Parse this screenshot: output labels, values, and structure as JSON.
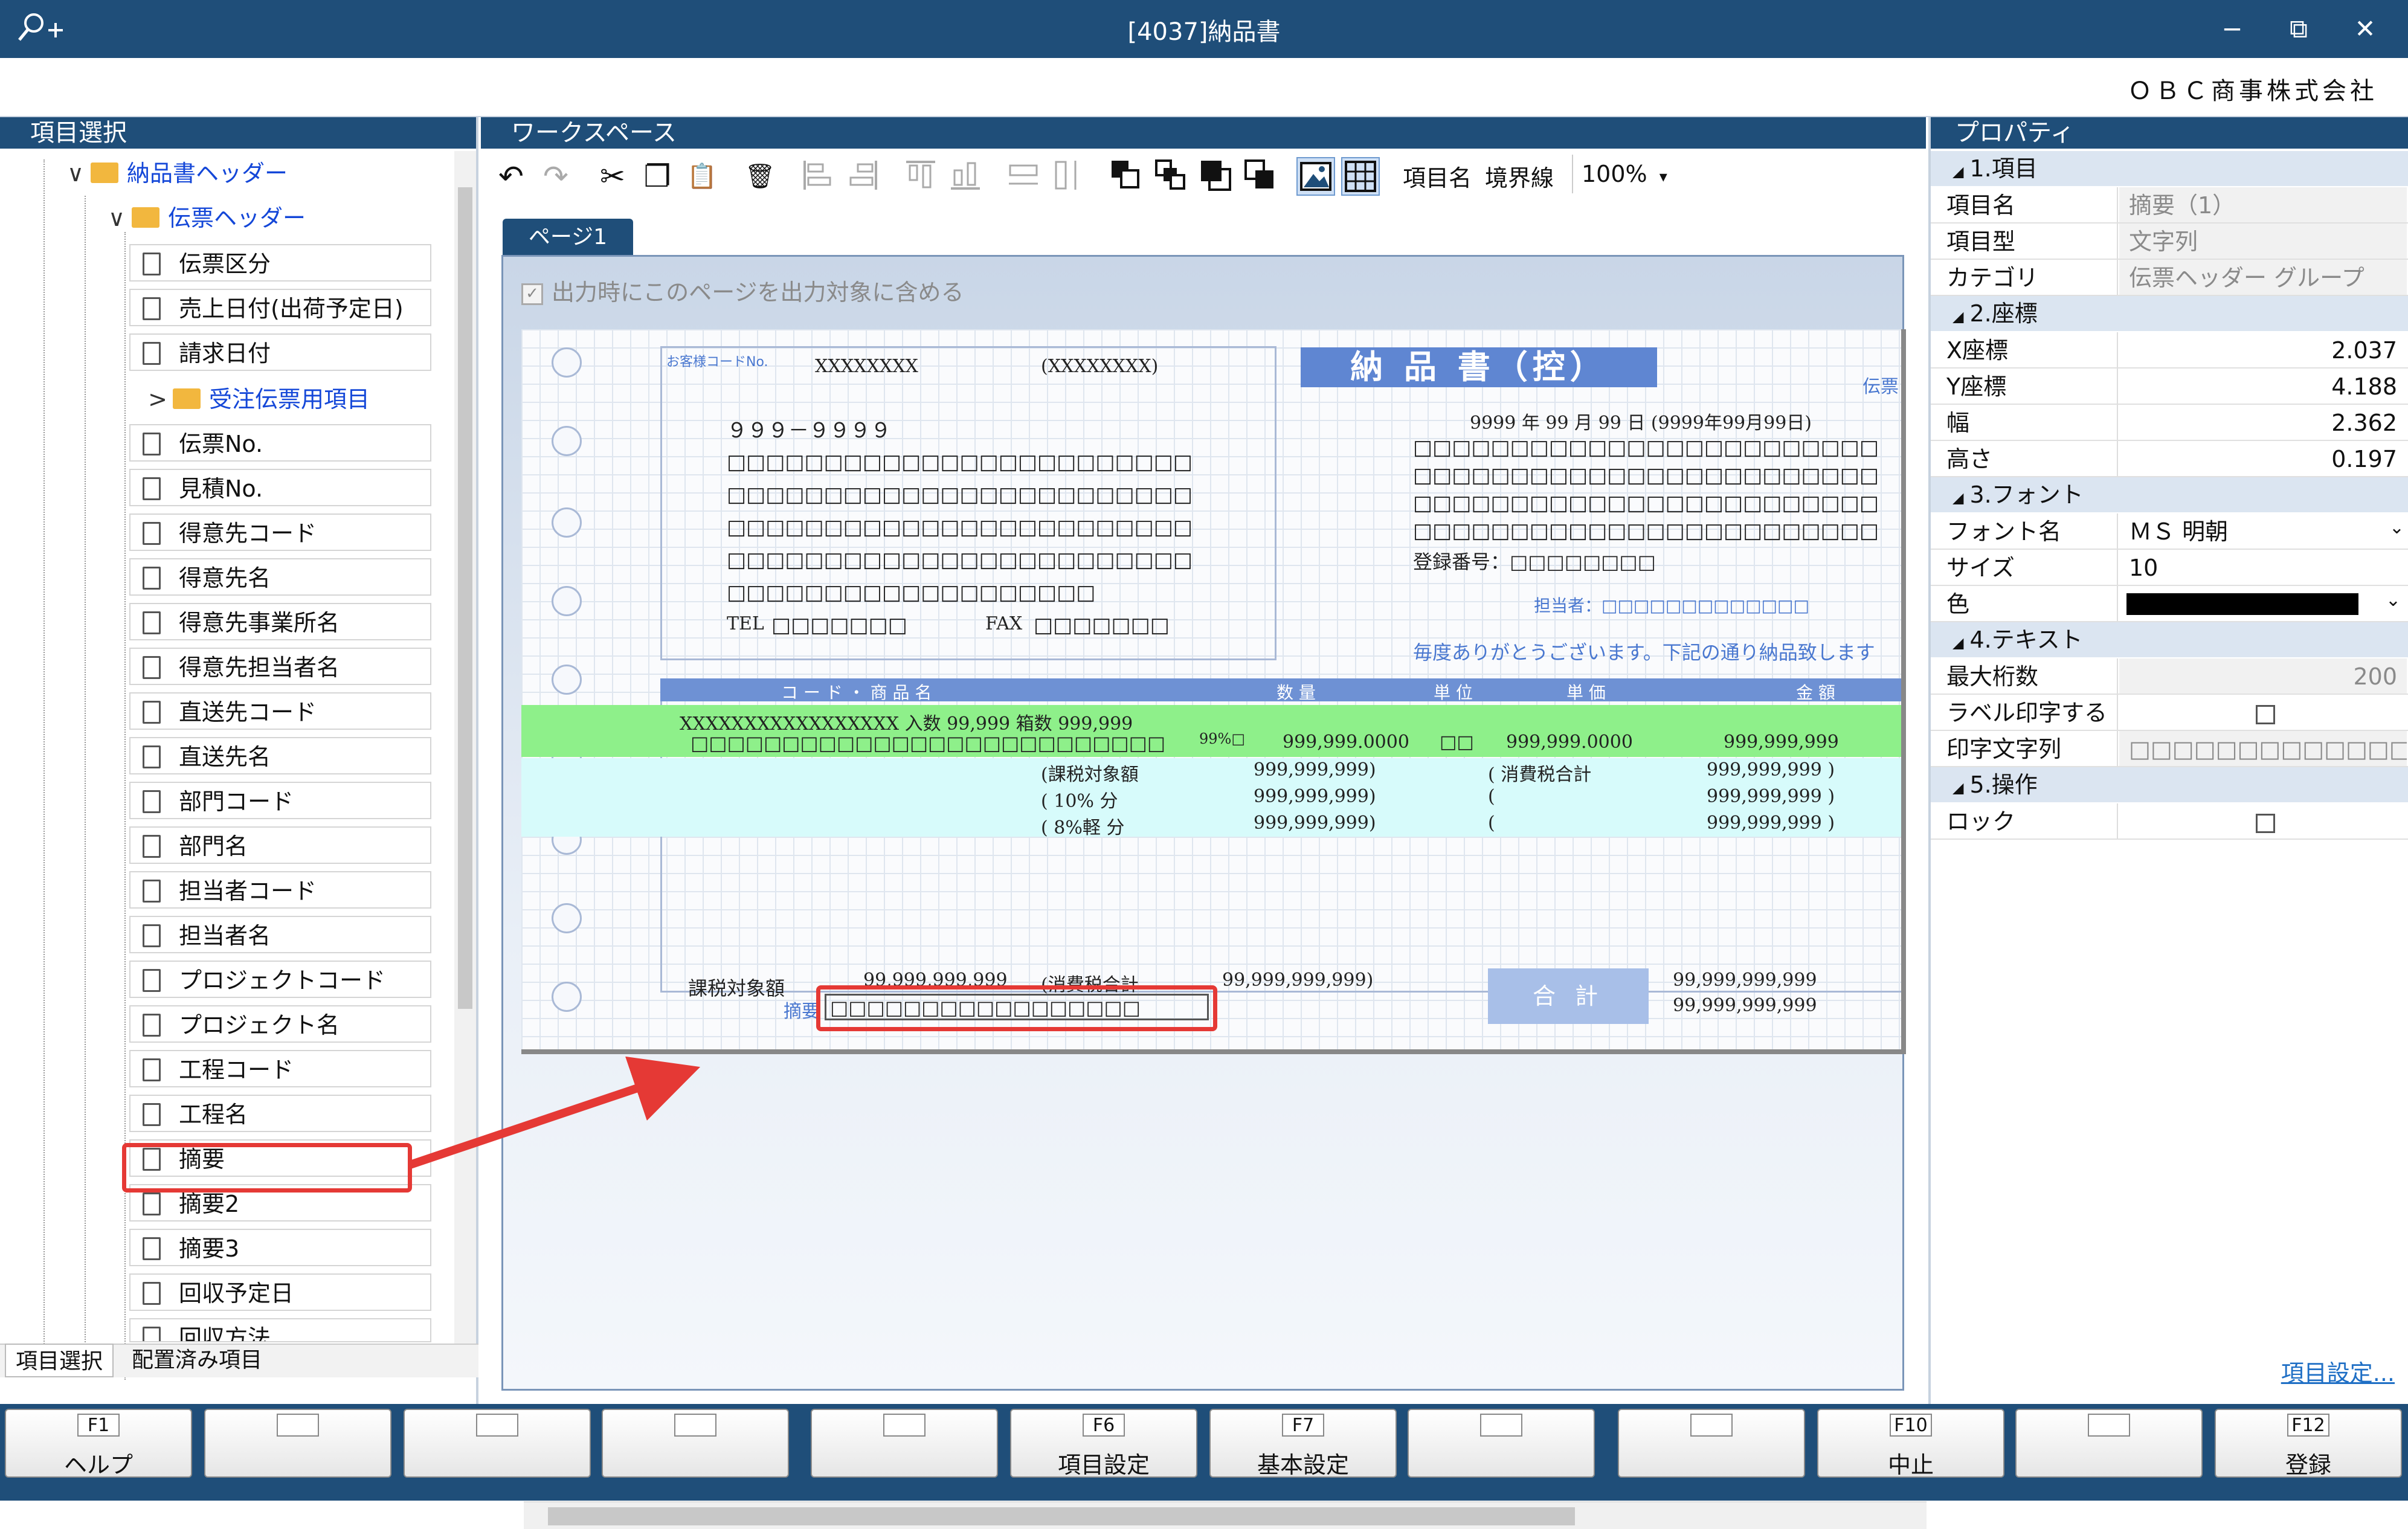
{
  "window": {
    "title": "[4037]納品書",
    "minimize": "−",
    "restore": "⧉",
    "close": "✕"
  },
  "company": "ＯＢＣ商事株式会社",
  "left_panel": {
    "header": "項目選択",
    "folders": [
      {
        "label": "納品書ヘッダー",
        "expand": "∨"
      },
      {
        "label": "伝票ヘッダー",
        "expand": "∨"
      },
      {
        "label": "受注伝票用項目",
        "expand": ">"
      }
    ],
    "items": [
      "伝票区分",
      "売上日付(出荷予定日)",
      "請求日付",
      "伝票No.",
      "見積No.",
      "得意先コード",
      "得意先名",
      "得意先事業所名",
      "得意先担当者名",
      "直送先コード",
      "直送先名",
      "部門コード",
      "部門名",
      "担当者コード",
      "担当者名",
      "プロジェクトコード",
      "プロジェクト名",
      "工程コード",
      "工程名",
      "摘要",
      "摘要2",
      "摘要3",
      "回収予定日",
      "回収方法"
    ],
    "tabs": [
      "項目選択",
      "配置済み項目"
    ]
  },
  "workspace": {
    "header": "ワークスペース",
    "toolbar": {
      "undo": "↶",
      "redo": "↷",
      "cut": "✂",
      "copy": "❐",
      "paste": "📋",
      "delete": "🗑",
      "item_name_label": "項目名",
      "border_label": "境界線",
      "zoom": "100%",
      "zoom_arrow": "▾"
    },
    "page_tab": "ページ1",
    "include_check": {
      "label": "出力時にこのページを出力対象に含める",
      "mark": "✓"
    },
    "form": {
      "customer_code_label": "お客様コードNo.",
      "customer_code": "XXXXXXXX",
      "customer_code_paren": "(XXXXXXXX)",
      "title": "納 品 書（控）",
      "denpyo": "伝票",
      "postal": "９９９－９９９９",
      "boxes_long": "□□□□□□□□□□□□□□□□□□□□□□□□",
      "boxes_mid": "□□□□□□□□□□□□□□□□□□□",
      "tel_label": "TEL",
      "tel_boxes": "□□□□□□□",
      "fax_label": "FAX",
      "fax_boxes": "□□□□□□□",
      "date": "9999 年 99 月 99 日 (9999年99月99日)",
      "reg_no": "登録番号：□□□□□□□□",
      "tantou": "担当者：□□□□□□□□□□□□□",
      "thanks": "毎度ありがとうございます。下記の通り納品致します",
      "col_code": "コ ー ド ・ 商 品 名",
      "col_qty": "数 量",
      "col_unit": "単 位",
      "col_price": "単 価",
      "col_amount": "金 額",
      "row1": "XXXXXXXXXXXXXXXXX 入数 99,999 箱数 999,999",
      "row1_boxes": "□□□□□□□□□□□□□□□□□□□□□□□□□□",
      "row1_pct": "99%□",
      "row1_qty": "999,999.0000",
      "row1_unit": "□□",
      "row1_price": "999,999.0000",
      "row1_amount": "999,999,999",
      "tax_target": "(課税対象額",
      "tax_10": "( 10% 分",
      "tax_8": "( 8%軽 分",
      "tax_val1": "999,999,999)",
      "tax_val2": "999,999,999)",
      "tax_val3": "999,999,999)",
      "tax_total_label": "( 消費税合計",
      "tax_total_1": "999,999,999 )",
      "tax_total_2": "999,999,999 )",
      "tax_total_3": "999,999,999 )",
      "footer_tax_label": "課税対象額",
      "footer_tax_val": "99,999,999,999",
      "footer_consump": "(消費税合計",
      "footer_consump_val": "99,999,999,999)",
      "goukei": "合 計",
      "goukei_1": "99,999,999,999",
      "goukei_2": "99,999,999,999",
      "tekiyou_label": "摘要",
      "tekiyou_boxes": "□□□□□□□□□□□□□□□□□"
    }
  },
  "properties": {
    "header": "プロパティ",
    "sections": [
      {
        "title": "1.項目",
        "rows": [
          {
            "name": "項目名",
            "value": "摘要（1）",
            "ro": true
          },
          {
            "name": "項目型",
            "value": "文字列",
            "ro": true
          },
          {
            "name": "カテゴリ",
            "value": "伝票ヘッダー グループ",
            "ro": true
          }
        ]
      },
      {
        "title": "2.座標",
        "rows": [
          {
            "name": "X座標",
            "value": "2.037"
          },
          {
            "name": "Y座標",
            "value": "4.188"
          },
          {
            "name": "幅",
            "value": "2.362"
          },
          {
            "name": "高さ",
            "value": "0.197"
          }
        ]
      },
      {
        "title": "3.フォント",
        "rows": [
          {
            "name": "フォント名",
            "value": "ＭＳ 明朝"
          },
          {
            "name": "サイズ",
            "value": "10"
          },
          {
            "name": "色",
            "value": ""
          }
        ]
      },
      {
        "title": "4.テキスト",
        "rows": [
          {
            "name": "最大桁数",
            "value": "200",
            "ro": true
          },
          {
            "name": "ラベル印字する",
            "value": ""
          },
          {
            "name": "印字文字列",
            "value": "□□□□□□□□□□□□□□",
            "ro": true
          }
        ]
      },
      {
        "title": "5.操作",
        "rows": [
          {
            "name": "ロック",
            "value": ""
          }
        ]
      }
    ],
    "collapse_glyph": "◢",
    "dropdown_glyph": "⌄",
    "link": "項目設定..."
  },
  "fkeys": [
    {
      "key": "F1",
      "label": "ヘルプ"
    },
    {
      "key": "",
      "label": ""
    },
    {
      "key": "",
      "label": ""
    },
    {
      "key": "",
      "label": ""
    },
    {
      "key": "",
      "label": ""
    },
    {
      "key": "F6",
      "label": "項目設定"
    },
    {
      "key": "F7",
      "label": "基本設定"
    },
    {
      "key": "",
      "label": ""
    },
    {
      "key": "",
      "label": ""
    },
    {
      "key": "F10",
      "label": "中止"
    },
    {
      "key": "",
      "label": ""
    },
    {
      "key": "F12",
      "label": "登録"
    }
  ],
  "colors": {
    "titlebar": "#1f4e79",
    "highlight": "#e53935",
    "green_row": "#8ef08a",
    "cyan_row": "#d7fbfb"
  }
}
